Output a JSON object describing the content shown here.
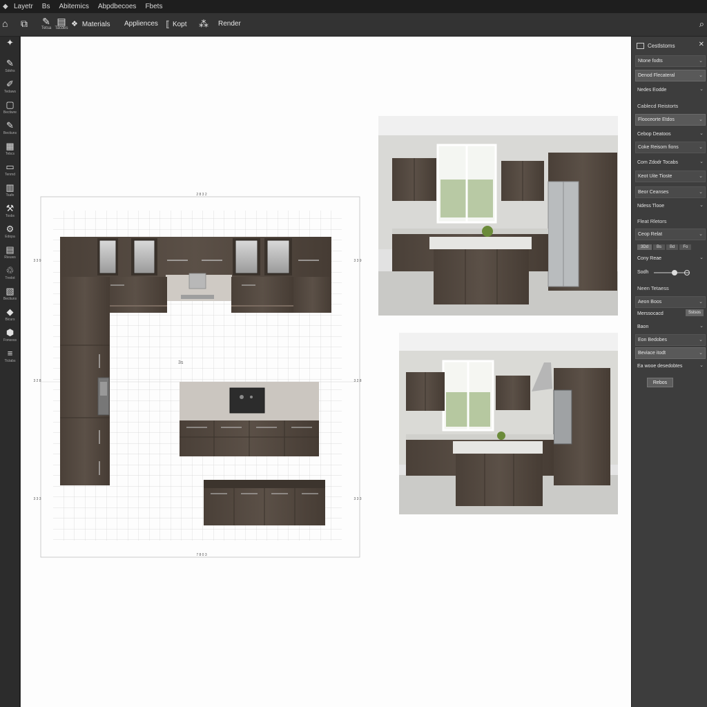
{
  "menu": [
    "Layetr",
    "Bs",
    "Abitemics",
    "Abpdbecoes",
    "Fbets"
  ],
  "toolbar": {
    "materials": "Materials",
    "appliances": "Appliences",
    "kopt": "Kopt",
    "render": "Render"
  },
  "left_tools": [
    {
      "icon": "brush-icon",
      "glyph": "✦",
      "label": ""
    },
    {
      "icon": "pen-icon",
      "glyph": "✎",
      "label": "Sdohs"
    },
    {
      "icon": "pencil-icon",
      "glyph": "✐",
      "label": "Tedaws"
    },
    {
      "icon": "square-icon",
      "glyph": "▢",
      "label": "Bectiwre"
    },
    {
      "icon": "edit-icon",
      "glyph": "✎",
      "label": "Bectiuns"
    },
    {
      "icon": "grid-icon",
      "glyph": "▦",
      "label": "Tebcs"
    },
    {
      "icon": "window-icon",
      "glyph": "▭",
      "label": "Tenmd"
    },
    {
      "icon": "stairs-icon",
      "glyph": "▥",
      "label": "Tsafe"
    },
    {
      "icon": "tools-icon",
      "glyph": "⚒",
      "label": "Tosbs"
    },
    {
      "icon": "cog-icon",
      "glyph": "⚙",
      "label": "Edopa"
    },
    {
      "icon": "door-icon",
      "glyph": "▤",
      "label": "Rieuws"
    },
    {
      "icon": "recycle-icon",
      "glyph": "♲",
      "label": "Tredot"
    },
    {
      "icon": "layout-icon",
      "glyph": "▧",
      "label": "Bectiuns"
    },
    {
      "icon": "diamond-icon",
      "glyph": "◆",
      "label": "Bicurs"
    },
    {
      "icon": "cube-icon",
      "glyph": "⬢",
      "label": "Fonsoss"
    },
    {
      "icon": "list-icon",
      "glyph": "≡",
      "label": "Tictabs"
    }
  ],
  "plan": {
    "dim_top": "2 8 3 2",
    "dim_bottom": "7 8 0 3",
    "dim_left_a": "3 3 9",
    "dim_left_b": "3 2 8",
    "dim_left_c": "3 3 3",
    "dim_right_a": "3 3 9",
    "dim_right_b": "3 2 8",
    "dim_right_c": "3 3 3",
    "cursor_label": "3s"
  },
  "panel": {
    "title": "Cestlstoms",
    "rows": [
      {
        "label": "Ntone fodts",
        "style": "box"
      },
      {
        "label": "Denod Flecateral",
        "style": "sel"
      },
      {
        "label": "Nedes Eodde",
        "style": "plain"
      },
      {
        "label": "Cablecd Reistorts",
        "style": "hdr"
      },
      {
        "label": "Flooceorte Etdos",
        "style": "sel"
      },
      {
        "label": "Cebop Deatoos",
        "style": "plain"
      },
      {
        "label": "Coke Reisom fions",
        "style": "box"
      },
      {
        "label": "Com Zdodr  Tocabs",
        "style": "plain"
      },
      {
        "label": "Keot Uite Tioste",
        "style": "box"
      },
      {
        "label": "Beor Ceanses",
        "style": "box"
      },
      {
        "label": "Ndess Tlooe",
        "style": "plain"
      },
      {
        "label": "Fleat Rletors",
        "style": "hdr"
      },
      {
        "label": "Ceop Relat",
        "style": "box"
      },
      {
        "label": "Cony Reae",
        "style": "plain"
      },
      {
        "label": "Sodh",
        "style": "plain"
      },
      {
        "label": "Neen Tetaess",
        "style": "hdr"
      },
      {
        "label": "Aeon Boos",
        "style": "box"
      },
      {
        "label": "Merssocacd",
        "style": "plain"
      },
      {
        "label": "Baon",
        "style": "plain"
      },
      {
        "label": "Eon Bedobes",
        "style": "box"
      },
      {
        "label": "Beviace itodt",
        "style": "sel"
      },
      {
        "label": "Ea wooe desedobtes",
        "style": "plain"
      }
    ],
    "seg": [
      "3Dd",
      "Bs",
      "Bd",
      "Fo"
    ],
    "tag": "Sstsos",
    "button": "Rebos"
  }
}
